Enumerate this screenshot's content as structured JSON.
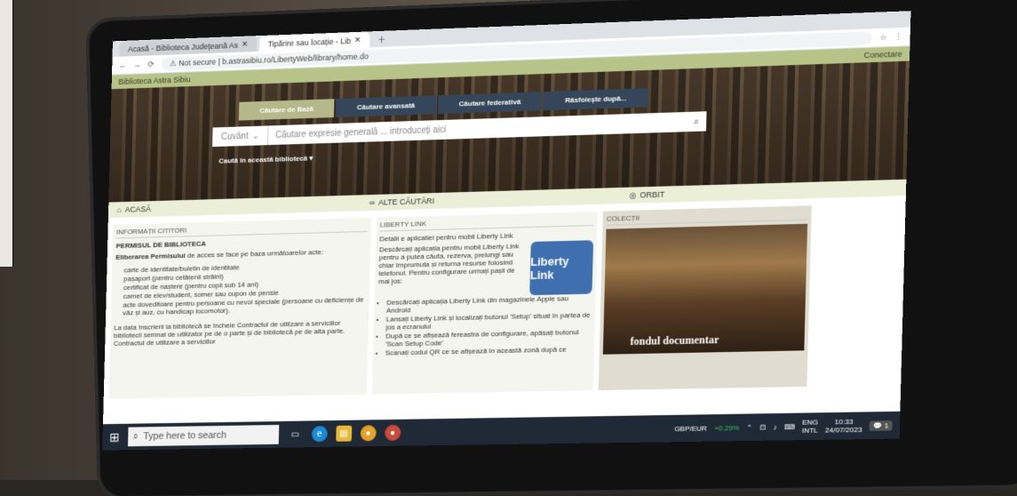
{
  "browser": {
    "tabs": [
      {
        "label": "Acasă - Biblioteca Județeană As"
      },
      {
        "label": "Tipărire sau locație - Lib"
      }
    ],
    "url_prefix": "Not secure",
    "url": "b.astrasibiu.ro/LibertyWeb/library/home.do"
  },
  "library": {
    "name": "Biblioteca Astra Sibiu",
    "login": "Conectare"
  },
  "search": {
    "tabs": [
      "Căutare de Bază",
      "Căutare avansată",
      "Căutare federativă",
      "Răsfoiește după..."
    ],
    "field": "Cuvânt",
    "placeholder": "Căutare expresie generală ... introduceți aici",
    "scope": "Caută în această bibliotecă"
  },
  "nav": {
    "home": "ACASĂ",
    "other": "ALTE CĂUTĂRI",
    "orbit": "ORBIT"
  },
  "info": {
    "header": "INFORMAȚII CITITORI",
    "subheader": "PERMISUL DE BIBLIOTECA",
    "intro_bold": "Eliberarea Permisului",
    "intro_rest": "de acces se face pe baza următoarelor acte:",
    "items": [
      "carte de identitate/buletin de identitate",
      "pașaport (pentru cetățenii străini)",
      "certificat de naștere (pentru copii sub 14 ani)",
      "carnet de elev/student, somer sau cupon de pensie",
      "acte doveditoare pentru persoane cu nevoi speciale (persoane cu deficiențe de văz și auz, cu handicap locomotor)."
    ],
    "footer": "La data înscrierii la bibliotecă se încheie Contractul de utilizare a serviciilor bibliotecii semnat de utilizator pe de o parte și de bibliotecă pe de alta parte. Contractul de utilizare a serviciilor"
  },
  "liberty": {
    "header": "LIBERTY LINK",
    "title": "Detalii e aplicatiei pentru mobil Liberty Link",
    "desc": "Descărcați aplicația pentru mobil Liberty Link pentru a putea căuta, rezerva, prelungi sau chiar împrumuta și returna resurse folosind telefonul. Pentru configurare urmați pașii de mai jos:",
    "logo_text": "Liberty Link",
    "steps": [
      "Descărcați aplicația Liberty Link din magazinele Apple sau Android",
      "Lansați Liberty Link și localizați butonul 'Setup' situat în partea de jos a ecranului",
      "După ce se afișează fereastra de configurare, apăsați butonul 'Scan Setup Code'",
      "Scanați codul QR ce se afișează în această zonă după ce"
    ]
  },
  "collection": {
    "header": "COLECȚII",
    "caption": "fondul documentar"
  },
  "taskbar": {
    "search_placeholder": "Type here to search",
    "ticker": "GBP/EUR",
    "ticker_change": "+0.29%",
    "lang": "ENG",
    "lang2": "INTL",
    "time": "10:33",
    "date": "24/07/2023",
    "notif_count": "1"
  }
}
